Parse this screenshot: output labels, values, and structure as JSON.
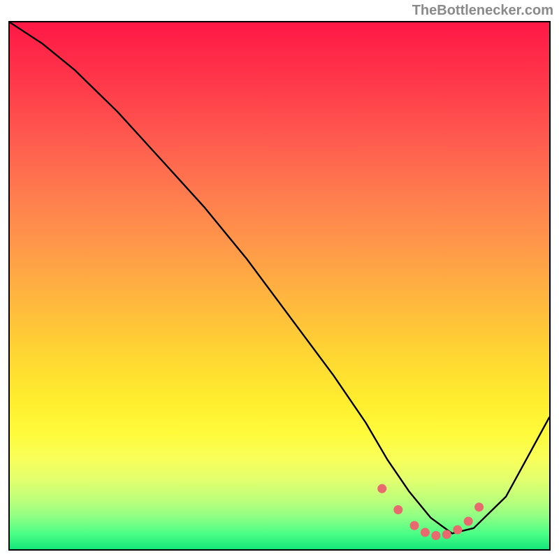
{
  "attribution": "TheBottlenecker.com",
  "chart_data": {
    "type": "line",
    "title": "",
    "xlabel": "",
    "ylabel": "",
    "xlim": [
      0,
      100
    ],
    "ylim": [
      0,
      100
    ],
    "series": [
      {
        "name": "bottleneck-curve",
        "x": [
          0,
          6,
          12,
          20,
          28,
          36,
          44,
          52,
          60,
          66,
          70,
          74,
          78,
          82,
          86,
          92,
          100
        ],
        "y": [
          100,
          96,
          91,
          83,
          74,
          65,
          55,
          44,
          33,
          24,
          17,
          11,
          6,
          3,
          4,
          10,
          25
        ]
      }
    ],
    "optimum_marker": {
      "name": "optimum-range",
      "x": [
        69,
        72,
        75,
        77,
        79,
        81,
        83,
        85,
        87
      ],
      "y": [
        11.5,
        7.5,
        4.5,
        3.2,
        2.6,
        2.8,
        3.7,
        5.3,
        8.0
      ]
    },
    "gradient_stops": [
      {
        "pos": 0,
        "color": "#ff1846"
      },
      {
        "pos": 50,
        "color": "#ffb53f"
      },
      {
        "pos": 80,
        "color": "#f8ff5a"
      },
      {
        "pos": 100,
        "color": "#14e67a"
      }
    ]
  }
}
